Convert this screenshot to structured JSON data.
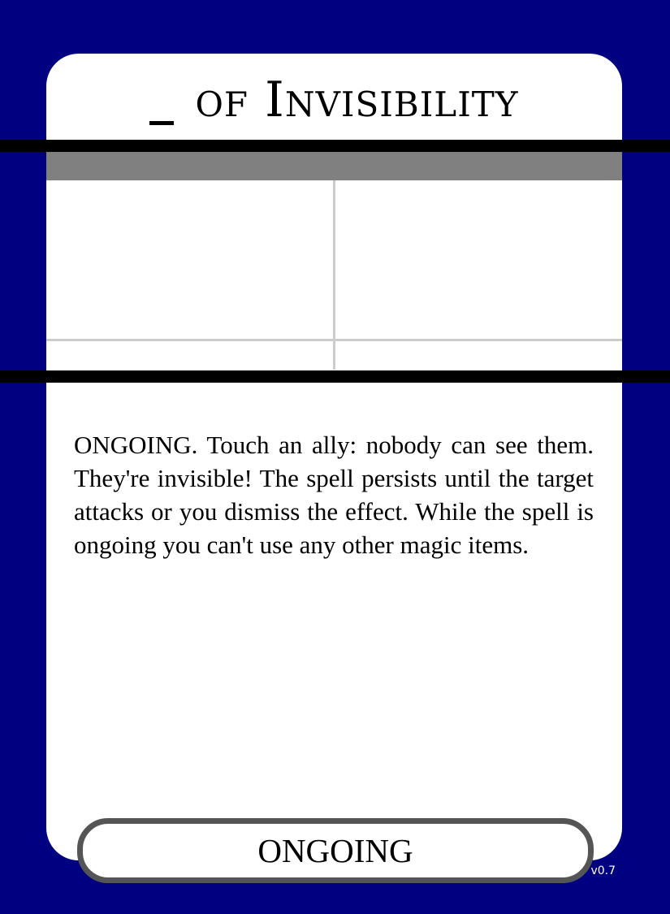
{
  "card": {
    "title": "of Invisibility",
    "description": "ONGOING. Touch an ally: nobody can see them. They're invisible! The spell persists until the target attacks or you dismiss the effect. While the spell is ongoing you can't use any other magic items.",
    "tag": "ONGOING",
    "version": "v0.7"
  },
  "colors": {
    "background": "#000080",
    "card": "#ffffff",
    "header_bar": "#808080",
    "divider": "#000000",
    "grid_lines": "#cccccc",
    "tag_border": "#555555"
  }
}
